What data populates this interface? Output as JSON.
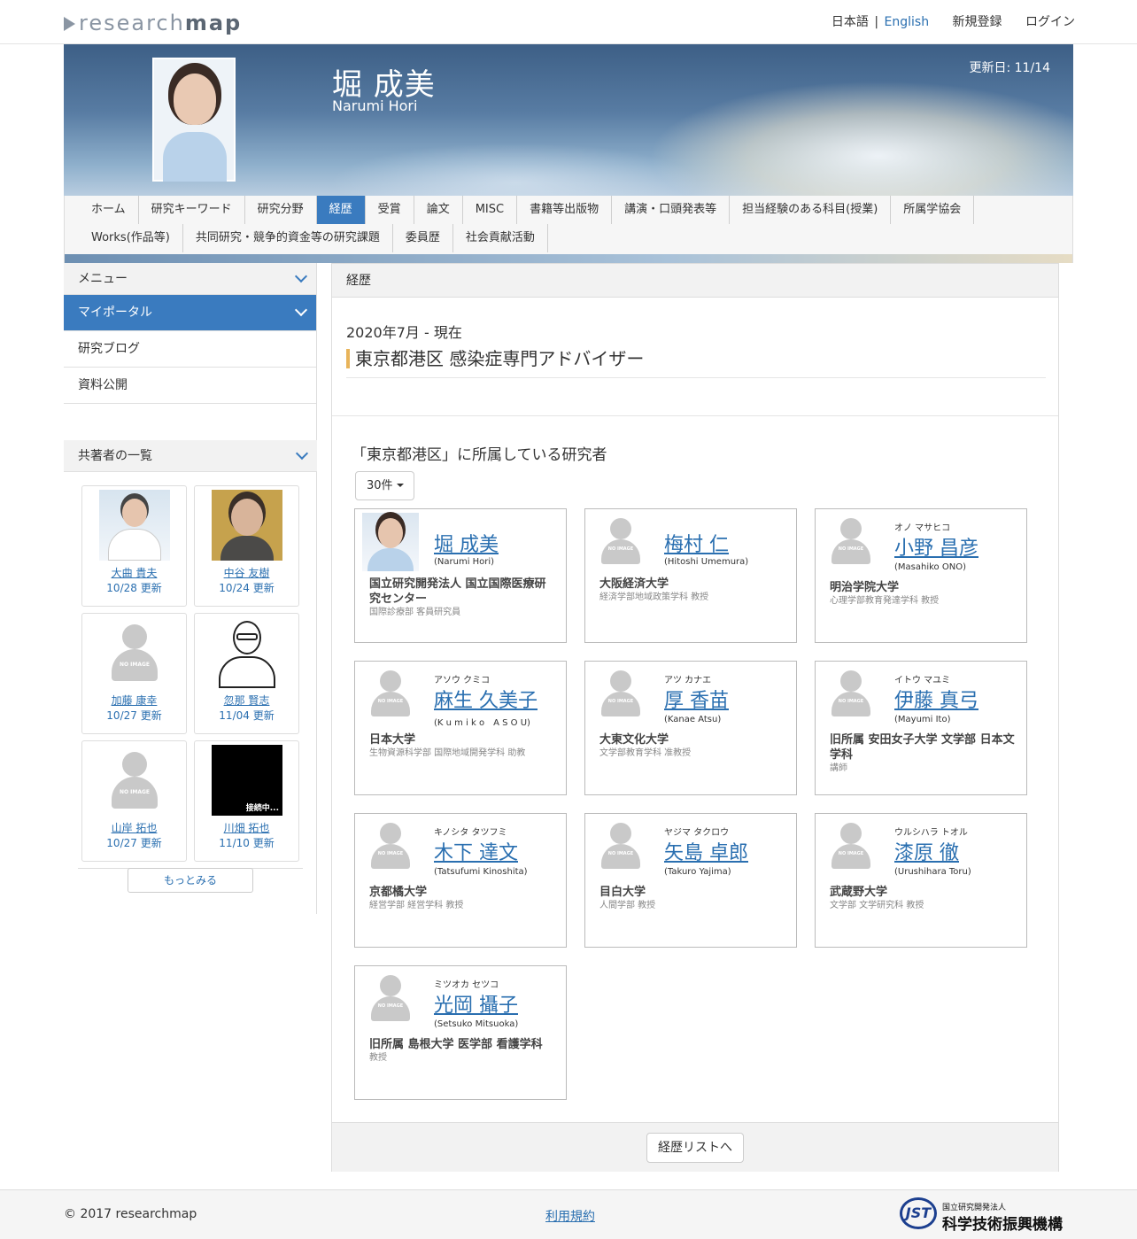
{
  "site": {
    "logo_light": "research",
    "logo_bold": "map"
  },
  "topnav": {
    "lang_ja": "日本語",
    "lang_sep": "|",
    "lang_en": "English",
    "register": "新規登録",
    "login": "ログイン"
  },
  "profile": {
    "name_ja": "堀 成美",
    "name_en": "Narumi Hori",
    "updated": "更新日: 11/14"
  },
  "tabs": {
    "row1": [
      "ホーム",
      "研究キーワード",
      "研究分野",
      "経歴",
      "受賞",
      "論文",
      "MISC",
      "書籍等出版物",
      "講演・口頭発表等",
      "担当経験のある科目(授業)",
      "所属学協会"
    ],
    "row2": [
      "Works(作品等)",
      "共同研究・競争的資金等の研究課題",
      "委員歴",
      "社会貢献活動"
    ],
    "active": "経歴"
  },
  "sidebar": {
    "menu_title": "メニュー",
    "items": [
      "マイポータル",
      "研究ブログ",
      "資料公開"
    ],
    "coauthors_title": "共著者の一覧",
    "coauthors": [
      {
        "name": "大曲 貴夫",
        "date": "10/28 更新"
      },
      {
        "name": "中谷 友樹",
        "date": "10/24 更新"
      },
      {
        "name": "加藤 康幸",
        "date": "10/27 更新"
      },
      {
        "name": "忽那 賢志",
        "date": "11/04 更新"
      },
      {
        "name": "山岸 拓也",
        "date": "10/27 更新"
      },
      {
        "name": "川畑 拓也",
        "date": "11/10 更新"
      }
    ],
    "connecting": "接続中...",
    "noimage": "NO IMAGE",
    "more": "もっとみる"
  },
  "main": {
    "section_title": "経歴",
    "period": "2020年7月 - 現在",
    "organization": "東京都港区 感染症専門アドバイザー",
    "belong_title": "「東京都港区」に所属している研究者",
    "count": "30件",
    "researchers": [
      {
        "kana": "",
        "name": "堀 成美",
        "en": "(Narumi Hori)",
        "aff": "国立研究開発法人 国立国際医療研究センター",
        "dept": "国際診療部 客員研究員"
      },
      {
        "kana": "",
        "name": "梅村 仁",
        "en": "(Hitoshi Umemura)",
        "aff": "大阪経済大学",
        "dept": "経済学部地域政策学科 教授"
      },
      {
        "kana": "オノ マサヒコ",
        "name": "小野 昌彦",
        "en": "(Masahiko ONO)",
        "aff": "明治学院大学",
        "dept": "心理学部教育発達学科 教授"
      },
      {
        "kana": "アソウ クミコ",
        "name": "麻生 久美子",
        "en": "(K u m i k o　A S O U)",
        "aff": "日本大学",
        "dept": "生物資源科学部 国際地域開発学科 助教"
      },
      {
        "kana": "アツ カナエ",
        "name": "厚 香苗",
        "en": "(Kanae Atsu)",
        "aff": "大東文化大学",
        "dept": "文学部教育学科 准教授"
      },
      {
        "kana": "イトウ マユミ",
        "name": "伊藤 真弓",
        "en": "(Mayumi Ito)",
        "aff": "旧所属 安田女子大学 文学部 日本文学科",
        "dept": "講師"
      },
      {
        "kana": "キノシタ タツフミ",
        "name": "木下 達文",
        "en": "(Tatsufumi Kinoshita)",
        "aff": "京都橘大学",
        "dept": "経営学部 経営学科 教授"
      },
      {
        "kana": "ヤジマ タクロウ",
        "name": "矢島 卓郎",
        "en": "(Takuro Yajima)",
        "aff": "目白大学",
        "dept": "人間学部 教授"
      },
      {
        "kana": "ウルシハラ トオル",
        "name": "漆原 徹",
        "en": "(Urushihara Toru)",
        "aff": "武蔵野大学",
        "dept": "文学部 文学研究科 教授"
      },
      {
        "kana": "ミツオカ セツコ",
        "name": "光岡 攝子",
        "en": "(Setsuko Mitsuoka)",
        "aff": "旧所属 島根大学 医学部 看護学科",
        "dept": "教授"
      }
    ],
    "list_button": "経歴リストへ"
  },
  "footer": {
    "copyright": "2017 researchmap",
    "terms": "利用規約",
    "jst_small": "国立研究開発法人",
    "jst_big": "科学技術振興機構",
    "jst_mark": "JST"
  }
}
